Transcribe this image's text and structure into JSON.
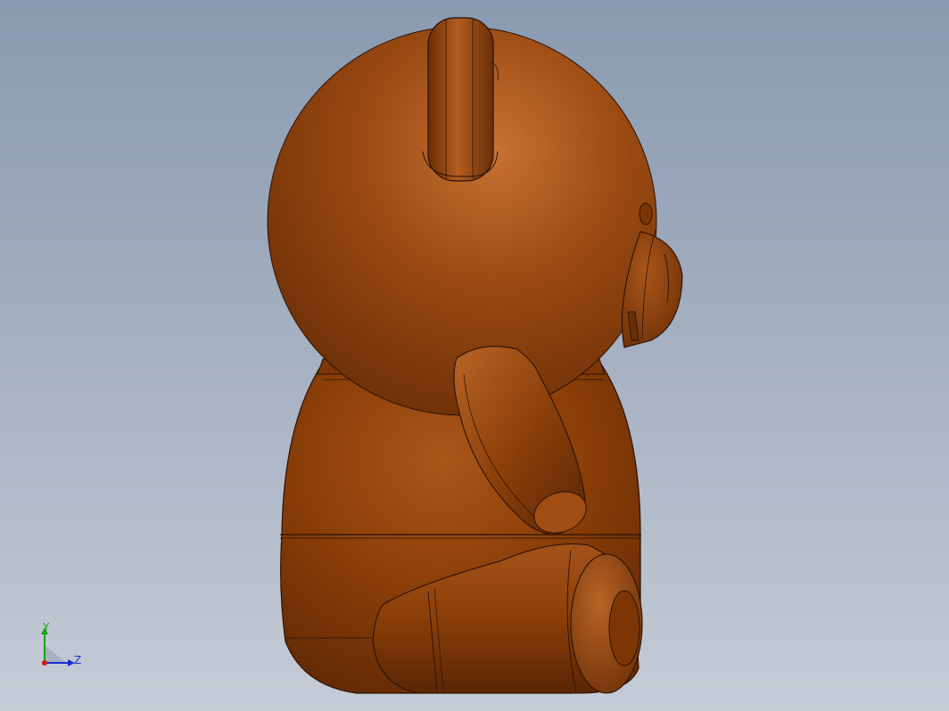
{
  "viewport": {
    "background_top": "#8a9ab0",
    "background_bottom": "#c6ccd6"
  },
  "model": {
    "name": "teddy-bear",
    "view": "side",
    "material_color": "#8a3e08",
    "highlight_color": "#c87234",
    "shadow_color": "#5a2604",
    "edge_color": "#2a1204"
  },
  "triad": {
    "axes": [
      {
        "label": "Y",
        "color": "#1aa31a"
      },
      {
        "label": "Z",
        "color": "#1a2fd0"
      }
    ],
    "origin_color": "#d01a1a"
  }
}
